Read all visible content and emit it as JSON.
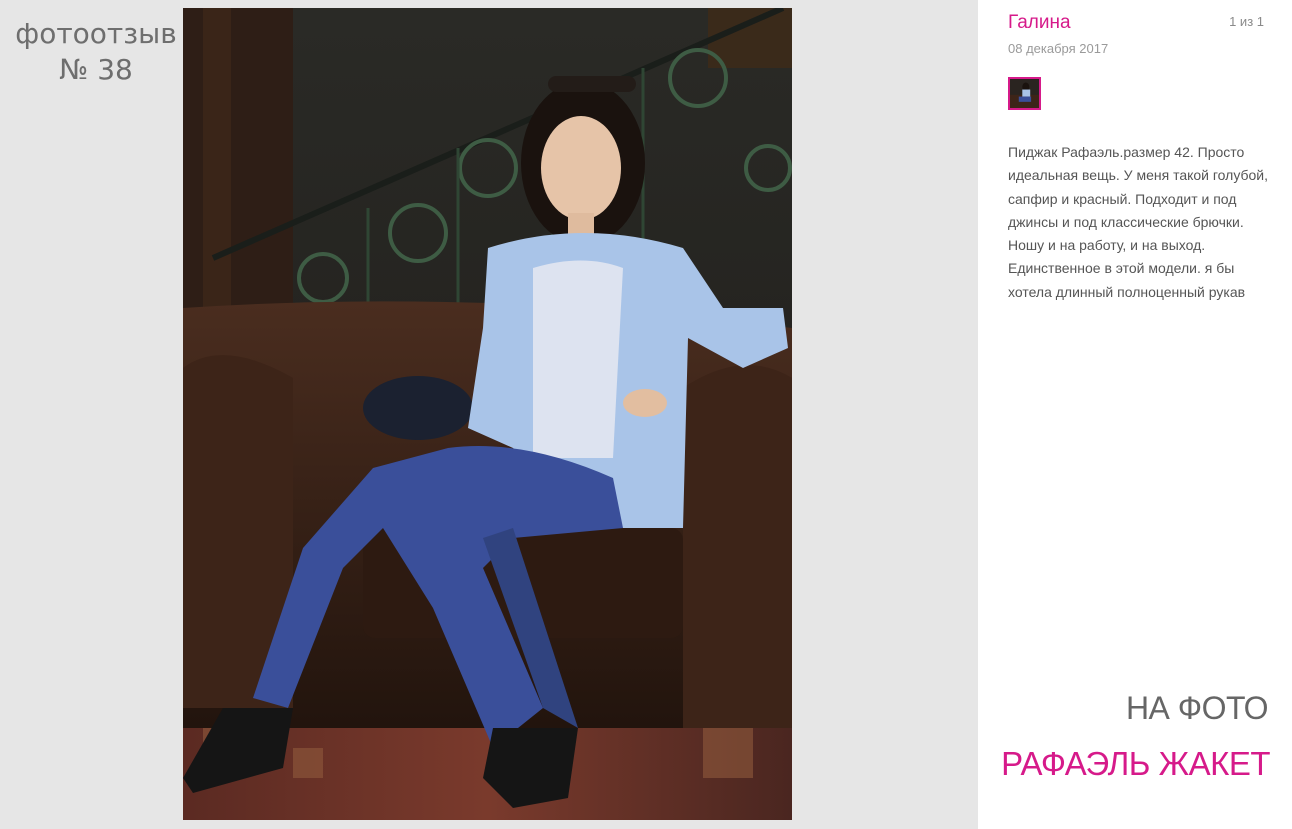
{
  "review": {
    "label_line1": "фотоотзыв",
    "label_line2": "№ 38"
  },
  "photo": {
    "description_colors": {
      "jacket": "#a9c4e8",
      "jeans": "#3a4f9a",
      "sofa": "#3a2419"
    }
  },
  "sidebar": {
    "author": "Галина",
    "counter": "1 из 1",
    "date": "08 декабря 2017",
    "text": "Пиджак Рафаэль.размер 42. Просто идеальная вещь. У меня такой голубой, сапфир и красный. Подходит и под джинсы и под классические брючки. Ношу и на работу, и на выход. Единственное в этой модели. я бы хотела длинный полноценный рукав",
    "on_photo_label": "НА ФОТО",
    "product_link": "РАФАЭЛЬ ЖАКЕТ"
  },
  "colors": {
    "accent": "#d61a8a",
    "muted": "#6e6e6e"
  }
}
